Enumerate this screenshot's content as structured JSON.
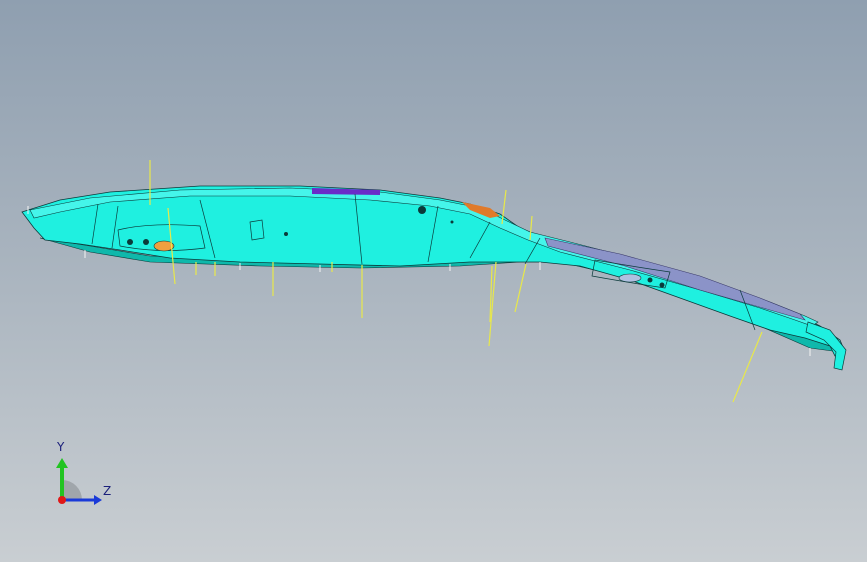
{
  "viewport": {
    "background_top": "#8f9fb0",
    "background_bottom": "#c9ced2"
  },
  "model": {
    "body_color": "#1ff0e0",
    "edge_color": "#0b3a3a",
    "guide_line_color": "#e8e84a",
    "accent_purple": "#6a2cc8",
    "accent_orange": "#e07a2a"
  },
  "triad": {
    "y_label": "Y",
    "z_label": "Z",
    "y_color": "#22c422",
    "z_color": "#1a3ad8",
    "x_color": "#e01818"
  }
}
